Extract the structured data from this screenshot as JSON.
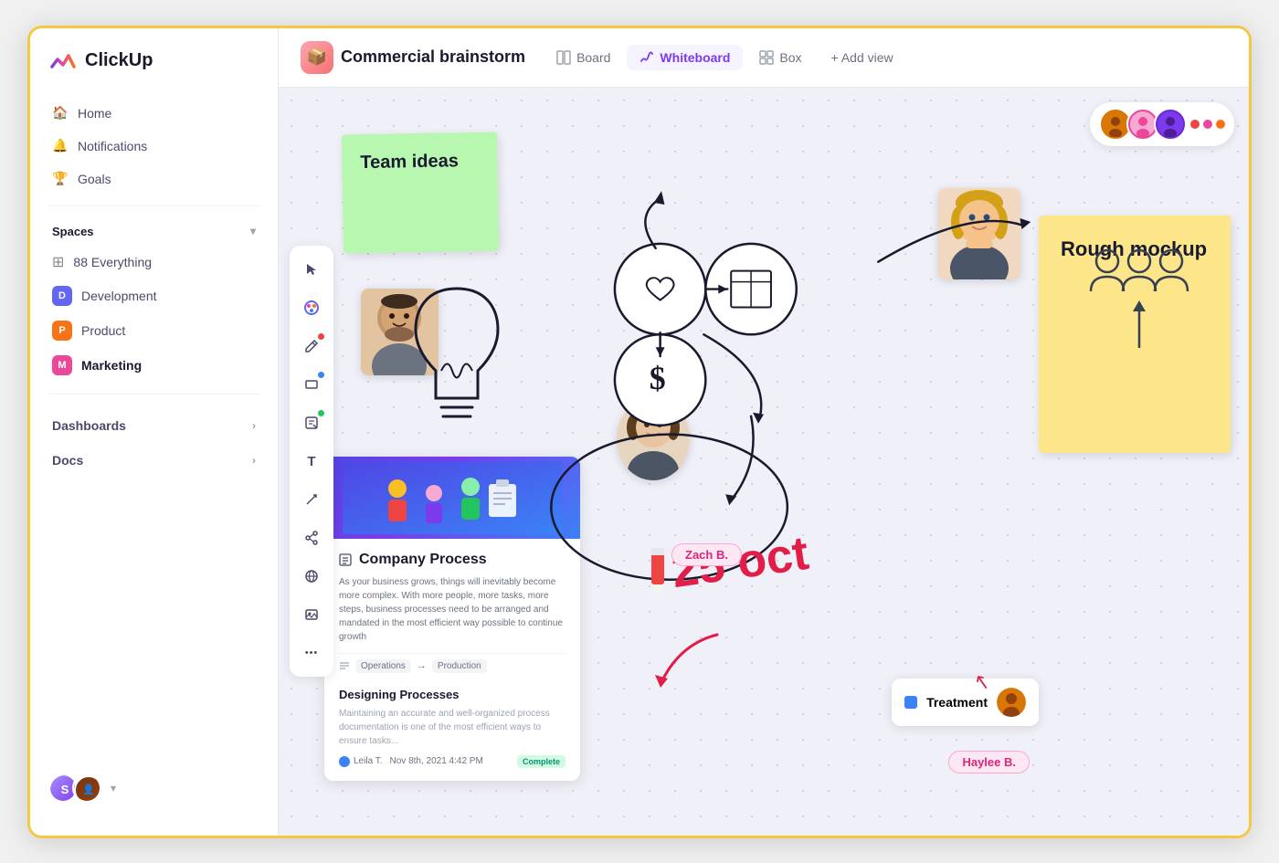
{
  "app": {
    "name": "ClickUp"
  },
  "sidebar": {
    "nav_items": [
      {
        "id": "home",
        "label": "Home",
        "icon": "🏠"
      },
      {
        "id": "notifications",
        "label": "Notifications",
        "icon": "🔔"
      },
      {
        "id": "goals",
        "label": "Goals",
        "icon": "🏆"
      }
    ],
    "spaces_label": "Spaces",
    "space_items": [
      {
        "id": "everything",
        "label": "88 Everything",
        "color": null
      },
      {
        "id": "development",
        "label": "Development",
        "color": "#6366f1",
        "letter": "D"
      },
      {
        "id": "product",
        "label": "Product",
        "color": "#f97316",
        "letter": "P"
      },
      {
        "id": "marketing",
        "label": "Marketing",
        "color": "#ec4899",
        "letter": "M",
        "active": true
      }
    ],
    "dashboards_label": "Dashboards",
    "docs_label": "Docs"
  },
  "topbar": {
    "icon": "📦",
    "title": "Commercial brainstorm",
    "tabs": [
      {
        "id": "whiteboard",
        "label": "Whiteboard",
        "active": true
      },
      {
        "id": "board",
        "label": "Board",
        "active": false
      },
      {
        "id": "box",
        "label": "Box",
        "active": false
      }
    ],
    "add_view_label": "+ Add view"
  },
  "canvas": {
    "sticky_green": {
      "text": "Team ideas",
      "bg": "#a7f3a0"
    },
    "sticky_yellow": {
      "text": "Rough mockup",
      "bg": "#fde68a"
    },
    "doc_card": {
      "title": "Company Process",
      "description": "As your business grows, things will inevitably become more complex. With more people, more tasks, more steps, business processes need to be arranged and mandated in the most efficient way possible to continue growth",
      "process_from": "Operations",
      "process_to": "Production",
      "section_title": "Designing Processes",
      "section_text": "Maintaining an accurate and well-organized process documentation is one of the most efficient ways to ensure tasks...",
      "user": "Leila T.",
      "date": "Nov 8th, 2021 4:42 PM",
      "status": "Complete"
    },
    "date_text": "25 oct",
    "person_labels": [
      {
        "id": "zach",
        "label": "Zach B."
      },
      {
        "id": "haylee",
        "label": "Haylee B."
      }
    ],
    "treatment_label": "Treatment",
    "collaborators": [
      {
        "id": "c1",
        "bg": "#d97706"
      },
      {
        "id": "c2",
        "bg": "#ec4899"
      },
      {
        "id": "c3",
        "bg": "#6d28d9"
      }
    ]
  },
  "toolbar": {
    "tools": [
      {
        "id": "select",
        "icon": "⬆",
        "dot": null
      },
      {
        "id": "color",
        "icon": "✦",
        "dot": null
      },
      {
        "id": "pencil",
        "icon": "✏",
        "dot": "red"
      },
      {
        "id": "rect",
        "icon": "□",
        "dot": "blue"
      },
      {
        "id": "note",
        "icon": "🗒",
        "dot": "green"
      },
      {
        "id": "text",
        "icon": "T",
        "dot": null
      },
      {
        "id": "connector",
        "icon": "↗",
        "dot": null
      },
      {
        "id": "share",
        "icon": "⌘",
        "dot": null
      },
      {
        "id": "globe",
        "icon": "🌐",
        "dot": null
      },
      {
        "id": "image",
        "icon": "🖼",
        "dot": null
      },
      {
        "id": "more",
        "icon": "···",
        "dot": null
      }
    ]
  }
}
